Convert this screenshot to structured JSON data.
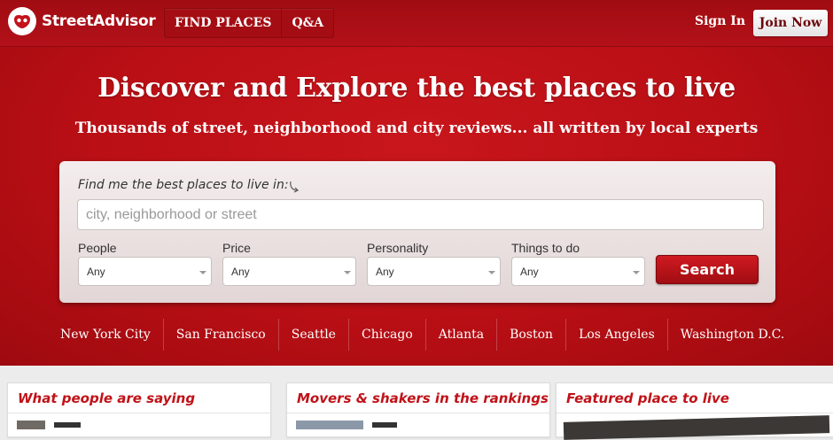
{
  "brand": {
    "name": "StreetAdvisor"
  },
  "nav": {
    "find_places": "FIND PLACES",
    "qa": "Q&A",
    "sign_in": "Sign In",
    "join_now": "Join Now"
  },
  "hero": {
    "headline": "Discover and Explore the best places to live",
    "subhead": "Thousands of street, neighborhood and city reviews... all written by local experts"
  },
  "search": {
    "label": "Find me the best places to live in:",
    "placeholder": "city, neighborhood or street",
    "filters": [
      {
        "label": "People",
        "value": "Any"
      },
      {
        "label": "Price",
        "value": "Any"
      },
      {
        "label": "Personality",
        "value": "Any"
      },
      {
        "label": "Things to do",
        "value": "Any"
      }
    ],
    "button": "Search"
  },
  "cities": [
    "New York City",
    "San Francisco",
    "Seattle",
    "Chicago",
    "Atlanta",
    "Boston",
    "Los Angeles",
    "Washington D.C."
  ],
  "panels": [
    {
      "title": "What people are saying"
    },
    {
      "title": "Movers & shakers in the rankings"
    },
    {
      "title": "Featured place to live"
    }
  ],
  "colors": {
    "brand_red": "#b90f15",
    "accent": "#c01218"
  }
}
